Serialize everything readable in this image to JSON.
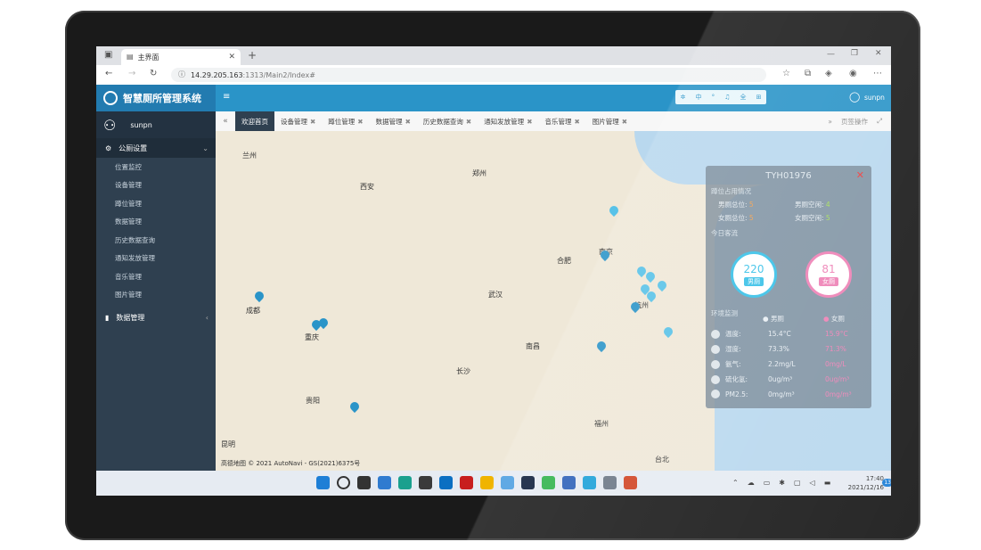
{
  "browser": {
    "tab_title": "主界面",
    "url_host": "14.29.205.163",
    "url_rest": ":1313/Main2/Index#"
  },
  "app": {
    "title": "智慧厕所管理系统",
    "user": "sunpn",
    "header_user": "sunpn",
    "kbd_keys": [
      "中",
      "°",
      "♫",
      "全",
      "⊞"
    ]
  },
  "sidebar": {
    "group1": "公厕设置",
    "items": [
      "位置监控",
      "设备管理",
      "蹲位管理",
      "数据管理",
      "历史数据查询",
      "通知发放管理",
      "音乐管理",
      "图片管理"
    ],
    "group2": "数据管理"
  },
  "page_tabs": [
    {
      "label": "欢迎首页",
      "active": true
    },
    {
      "label": "设备管理",
      "active": false
    },
    {
      "label": "蹲位管理",
      "active": false
    },
    {
      "label": "数据管理",
      "active": false
    },
    {
      "label": "历史数据查询",
      "active": false
    },
    {
      "label": "通知发放管理",
      "active": false
    },
    {
      "label": "音乐管理",
      "active": false
    },
    {
      "label": "图片管理",
      "active": false
    }
  ],
  "tab_ops": "页签操作",
  "map": {
    "cities": [
      {
        "name": "兰州"
      },
      {
        "name": "西安"
      },
      {
        "name": "郑州"
      },
      {
        "name": "合肥"
      },
      {
        "name": "南京"
      },
      {
        "name": "武汉"
      },
      {
        "name": "成都"
      },
      {
        "name": "重庆"
      },
      {
        "name": "长沙"
      },
      {
        "name": "南昌"
      },
      {
        "name": "杭州"
      },
      {
        "name": "贵阳"
      },
      {
        "name": "福州"
      },
      {
        "name": "台北"
      },
      {
        "name": "昆明"
      }
    ],
    "attribution": "高德地图 © 2021 AutoNavi - GS(2021)6375号"
  },
  "panel": {
    "title": "TYH01976",
    "section_seats": "蹲位占用情况",
    "male_total_label": "男厕总位:",
    "male_total": "5",
    "male_free_label": "男厕空闲:",
    "male_free": "4",
    "female_total_label": "女厕总位:",
    "female_total": "5",
    "female_free_label": "女厕空闲:",
    "female_free": "5",
    "section_today": "今日客流",
    "male_count": "220",
    "male_label": "男厕",
    "female_count": "81",
    "female_label": "女厕",
    "section_env": "环境监测",
    "col_male": "男厕",
    "col_female": "女厕",
    "env": [
      {
        "label": "温度:",
        "male": "15.4°C",
        "female": "15.9°C"
      },
      {
        "label": "湿度:",
        "male": "73.3%",
        "female": "71.3%"
      },
      {
        "label": "氨气:",
        "male": "2.2mg/L",
        "female": "0mg/L"
      },
      {
        "label": "硫化氢:",
        "male": "0ug/m³",
        "female": "0ug/m³"
      },
      {
        "label": "PM2.5:",
        "male": "0mg/m³",
        "female": "0mg/m³"
      }
    ]
  },
  "taskbar": {
    "time": "17:40",
    "date": "2021/12/16",
    "badge": "13"
  },
  "colors": {
    "brand": "#2a94c8",
    "sidebar": "#2f4050",
    "pin": "#2a94c8",
    "female": "#ee82b6",
    "male_circle": "#39c1e8"
  }
}
